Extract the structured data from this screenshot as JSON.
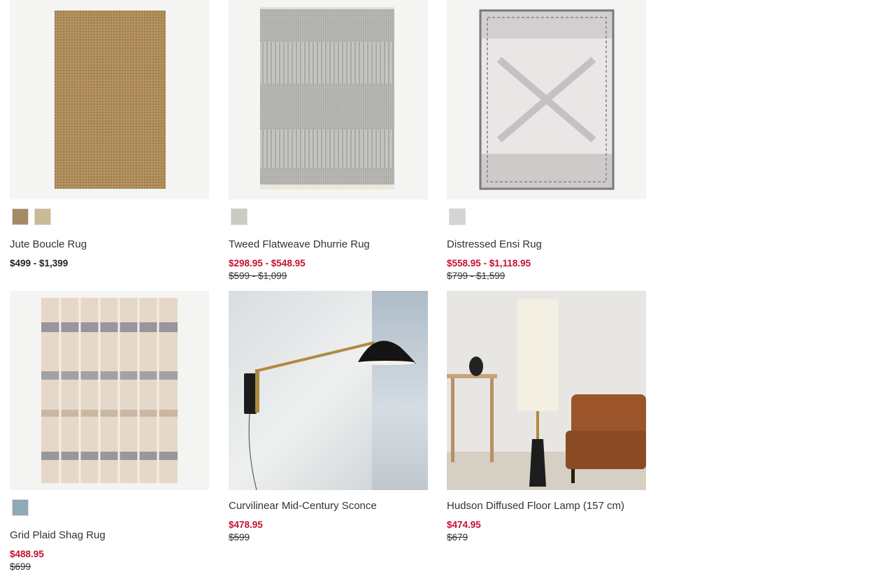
{
  "products": [
    {
      "name": "Jute Boucle Rug",
      "price": "$499 - $1,399",
      "price_type": "regular",
      "swatches": [
        "#a48b63",
        "#cbbb94"
      ]
    },
    {
      "name": "Tweed Flatweave Dhurrie Rug",
      "price": "$298.95 - $548.95",
      "original_price": "$599 - $1,099",
      "price_type": "sale",
      "swatches": [
        "#c9cbc5"
      ]
    },
    {
      "name": "Distressed Ensi Rug",
      "price": "$558.95 - $1,118.95",
      "original_price": "$799 - $1,599",
      "price_type": "sale",
      "swatches": [
        "#d6d3d6"
      ]
    },
    {
      "name": "Grid Plaid Shag Rug",
      "price": "$488.95",
      "original_price": "$699",
      "price_type": "sale",
      "swatches": [
        "#8fa9b8"
      ]
    },
    {
      "name": "Curvilinear Mid-Century Sconce",
      "price": "$478.95",
      "original_price": "$599",
      "price_type": "sale",
      "swatches": []
    },
    {
      "name": "Hudson Diffused Floor Lamp (157 cm)",
      "price": "$474.95",
      "original_price": "$679",
      "price_type": "sale",
      "swatches": []
    }
  ],
  "colors": {
    "sale": "#c4102f",
    "text": "#333333"
  }
}
